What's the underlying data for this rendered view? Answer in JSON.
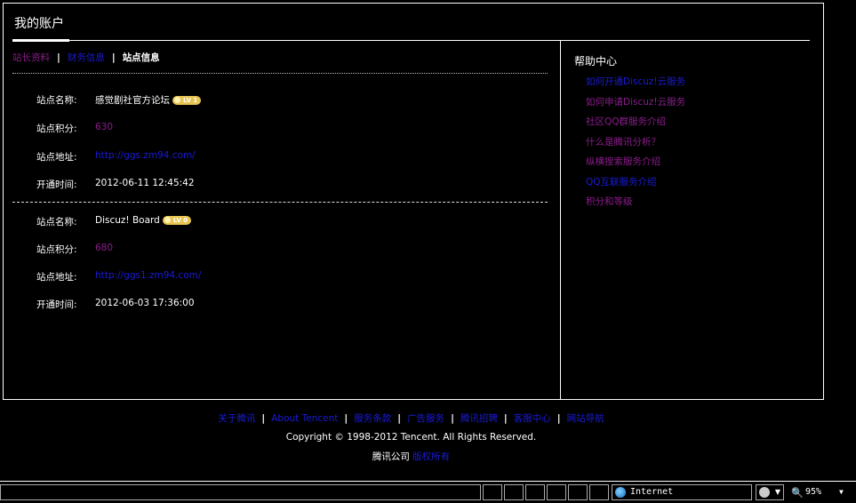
{
  "page": {
    "title": "我的账户"
  },
  "tabs": [
    {
      "label": "站长资料"
    },
    {
      "label": "财务信息"
    },
    {
      "label": "站点信息"
    }
  ],
  "tab_separator": "|",
  "sites": [
    {
      "name_label": "站点名称:",
      "name": "感觉剧社官方论坛",
      "level_badge": "LV 1",
      "score_label": "站点积分:",
      "score": "630",
      "url_label": "站点地址:",
      "url": "http://ggs.zm94.com/",
      "opened_label": "开通时间:",
      "opened": "2012-06-11 12:45:42"
    },
    {
      "name_label": "站点名称:",
      "name": "Discuz! Board",
      "level_badge": "LV 0",
      "score_label": "站点积分:",
      "score": "680",
      "url_label": "站点地址:",
      "url": "http://ggs1.zm94.com/",
      "opened_label": "开通时间:",
      "opened": "2012-06-03 17:36:00"
    }
  ],
  "help": {
    "title": "帮助中心",
    "items": [
      "如何开通Discuz!云服务",
      "如何申请Discuz!云服务",
      "社区QQ群服务介绍",
      "什么是腾讯分析？",
      "纵横搜索服务介绍",
      "QQ互联服务介绍",
      "积分和等级"
    ]
  },
  "footer": {
    "links": [
      "关于腾讯",
      "About Tencent",
      "服务条款",
      "广告服务",
      "腾讯招聘",
      "客服中心",
      "网站导航"
    ],
    "separator": "|",
    "copyright": "Copyright © 1998-2012 Tencent. All Rights Reserved.",
    "company": "腾讯公司",
    "rights": "版权所有"
  },
  "statusbar": {
    "zone": "Internet",
    "zoom": "95%",
    "icons": {
      "zone": "globe-icon",
      "protected_mode": "shield-icon",
      "zoom": "magnifier-icon"
    }
  },
  "colors": {
    "background": "#000000",
    "link": "#1a1ad6",
    "visited": "#8b1d8b",
    "text": "#ffffff"
  }
}
